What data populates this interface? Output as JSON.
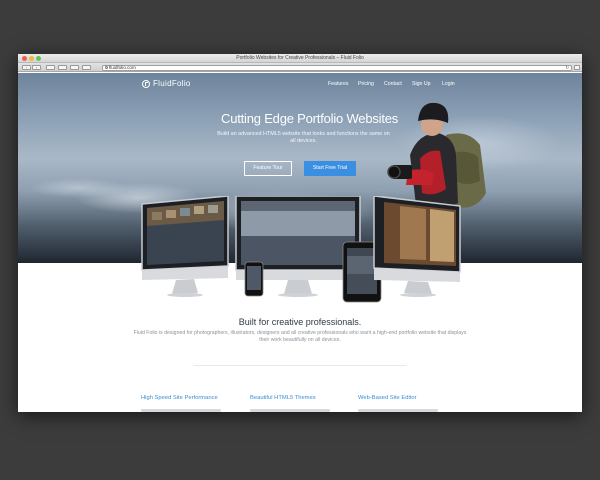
{
  "window": {
    "title": "Portfolio Websites for Creative Professionals – Fluid Folio",
    "url": "fluidfolio.com"
  },
  "site": {
    "logo_text": "FluidFolio",
    "nav": [
      "Features",
      "Pricing",
      "Contact",
      "Sign Up",
      "Login"
    ]
  },
  "hero": {
    "title": "Cutting Edge Portfolio Websites",
    "subtitle": "Build an advanced HTML5 website that looks and functions the same on all devices.",
    "button_tour": "Feature Tour",
    "button_trial": "Start Free Trial"
  },
  "intro": {
    "title": "Built for creative professionals.",
    "body": "Fluid Folio is designed for photographers, illustrators, designers and all creative professionals who want a high-end portfolio website that displays their work beautifully on all devices."
  },
  "features": [
    "High Speed Site Performance",
    "Beautiful HTML5 Themes",
    "Web-Based Site Editor"
  ],
  "colors": {
    "accent": "#3a8fe2",
    "feature_link": "#3b8dd8",
    "backdrop": "#3c3c3c"
  },
  "icons": [
    "back-icon",
    "forward-icon",
    "globe-icon",
    "reload-icon",
    "logo-icon"
  ]
}
